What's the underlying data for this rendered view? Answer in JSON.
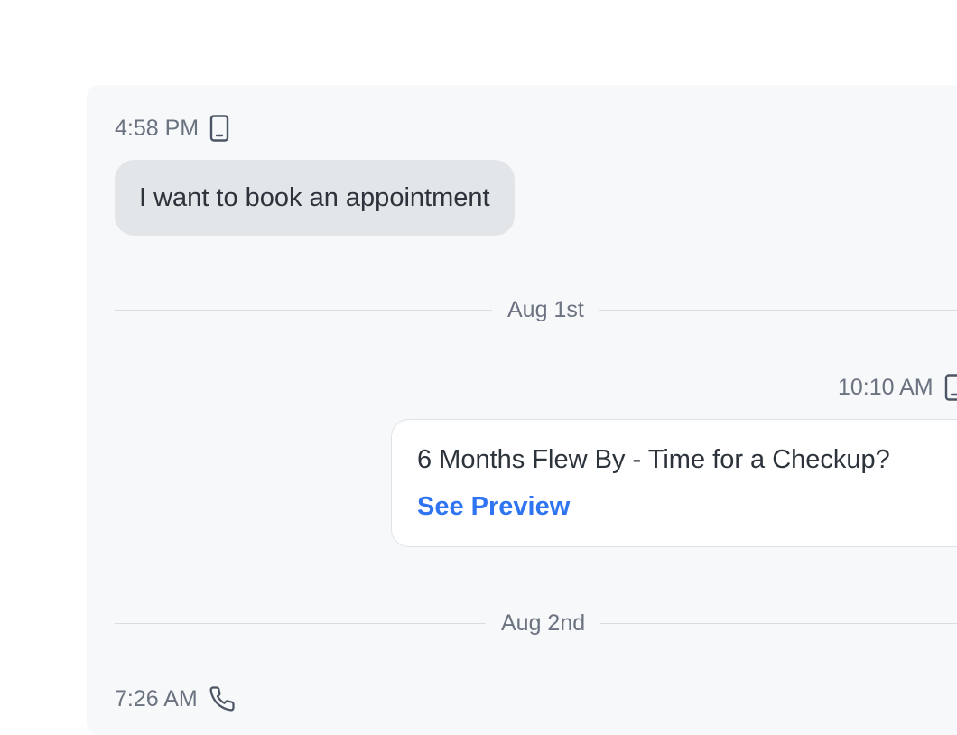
{
  "thread": {
    "messages": [
      {
        "direction": "incoming",
        "time": "4:58 PM",
        "channel_icon": "mobile-phone-icon",
        "text": "I want to book an appointment"
      },
      {
        "direction": "outgoing",
        "time": "10:10 AM",
        "channel_icon": "mobile-phone-icon",
        "title": "6 Months Flew By - Time for a Checkup?",
        "link_label": "See Preview"
      },
      {
        "direction": "incoming",
        "time": "7:26 AM",
        "channel_icon": "phone-call-icon"
      }
    ],
    "date_separators": [
      "Aug 1st",
      "Aug 2nd"
    ]
  },
  "colors": {
    "panel_background": "#f7f8fa",
    "incoming_bubble": "#e3e6e9",
    "outgoing_card": "#ffffff",
    "link": "#2f74f0",
    "muted_text": "#6b7280"
  }
}
